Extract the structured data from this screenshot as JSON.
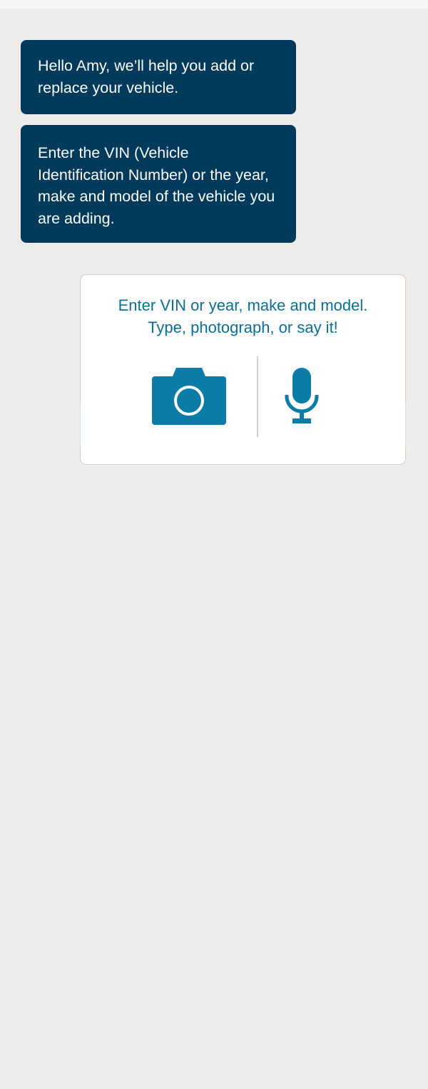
{
  "conversation": {
    "messages": [
      {
        "text": "Hello Amy, we’ll help you add or replace your vehicle."
      },
      {
        "text": "Enter the VIN (Vehicle Identification Number) or the year, make and model of the vehicle you are adding."
      }
    ]
  },
  "vehicle_input": {
    "prompt_line_1": "Enter VIN or year, make and model.",
    "prompt_line_2": "Type, photograph, or say it!",
    "camera_icon": "camera-icon",
    "mic_icon": "microphone-icon"
  },
  "colors": {
    "page_background": "#edecea",
    "bubble_background": "#023a5c",
    "bubble_text": "#ffffff",
    "accent": "#0a6f94",
    "icon": "#0b7ca8",
    "card_border": "#cfcfcf"
  }
}
